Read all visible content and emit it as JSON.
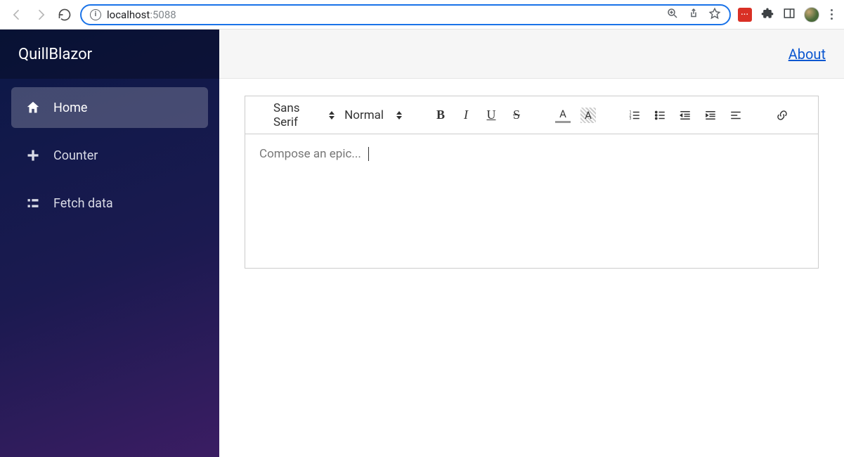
{
  "browser": {
    "url_host": "localhost",
    "url_port": ":5088"
  },
  "sidebar": {
    "brand": "QuillBlazor",
    "items": [
      {
        "label": "Home"
      },
      {
        "label": "Counter"
      },
      {
        "label": "Fetch data"
      }
    ]
  },
  "topbar": {
    "about": "About"
  },
  "editor": {
    "font_select": "Sans Serif",
    "size_select": "Normal",
    "placeholder": "Compose an epic..."
  }
}
